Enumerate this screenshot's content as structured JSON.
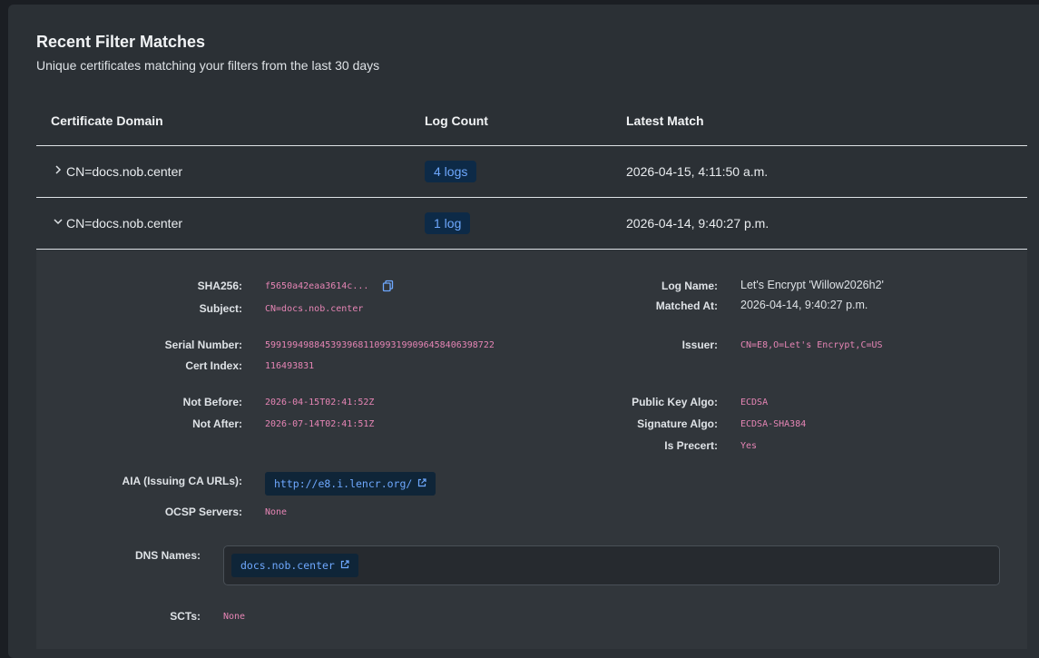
{
  "header": {
    "title": "Recent Filter Matches",
    "subtitle": "Unique certificates matching your filters from the last 30 days"
  },
  "table": {
    "columns": [
      "Certificate Domain",
      "Log Count",
      "Latest Match"
    ],
    "rows": [
      {
        "domain": "CN=docs.nob.center",
        "log_count": "4 logs",
        "latest": "2026-04-15, 4:11:50 a.m.",
        "expanded": false
      },
      {
        "domain": "CN=docs.nob.center",
        "log_count": "1 log",
        "latest": "2026-04-14, 9:40:27 p.m.",
        "expanded": true
      }
    ]
  },
  "details": {
    "labels": {
      "sha256": "SHA256:",
      "subject": "Subject:",
      "serial": "Serial Number:",
      "cert_index": "Cert Index:",
      "not_before": "Not Before:",
      "not_after": "Not After:",
      "aia": "AIA (Issuing CA URLs):",
      "ocsp": "OCSP Servers:",
      "dns": "DNS Names:",
      "scts": "SCTs:",
      "log_name": "Log Name:",
      "matched_at": "Matched At:",
      "issuer": "Issuer:",
      "pk_algo": "Public Key Algo:",
      "sig_algo": "Signature Algo:",
      "precert": "Is Precert:"
    },
    "values": {
      "sha256": "f5650a42eaa3614c...",
      "subject": "CN=docs.nob.center",
      "serial": "599199498845393968110993199096458406398722",
      "cert_index": "116493831",
      "not_before": "2026-04-15T02:41:52Z",
      "not_after": "2026-07-14T02:41:51Z",
      "aia": "http://e8.i.lencr.org/",
      "ocsp": "None",
      "dns": "docs.nob.center",
      "scts": "None",
      "log_name": "Let's Encrypt 'Willow2026h2'",
      "matched_at": "2026-04-14, 9:40:27 p.m.",
      "issuer": "CN=E8,O=Let's Encrypt,C=US",
      "pk_algo": "ECDSA",
      "sig_algo": "ECDSA-SHA384",
      "precert": "Yes"
    }
  },
  "icons": {
    "copy": "copy-icon",
    "external": "external-link-icon",
    "chevron_right": "chevron-right-icon",
    "chevron_down": "chevron-down-icon"
  },
  "colors": {
    "panel": "#2b3035",
    "code": "#e685b5",
    "link": "#6ea8fe",
    "badge_bg": "#0d2a47"
  }
}
